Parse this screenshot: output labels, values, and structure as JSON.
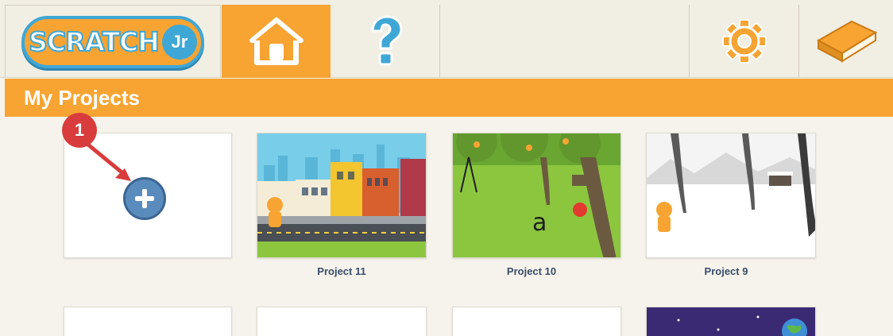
{
  "app": {
    "logo_text": "SCRATCH",
    "logo_suffix": "Jr"
  },
  "toolbar": {
    "home_icon": "home-icon",
    "help_icon": "question-icon",
    "settings_icon": "gear-icon",
    "book_icon": "book-icon"
  },
  "section": {
    "title": "My Projects"
  },
  "annotation": {
    "step": "1"
  },
  "projects": [
    {
      "label": "Project 11"
    },
    {
      "label": "Project 10"
    },
    {
      "label": "Project 9"
    }
  ],
  "colors": {
    "accent": "#f7a433",
    "logo_blue": "#3fa7d6",
    "badge": "#d93c3c",
    "plus": "#5a8bbd"
  }
}
